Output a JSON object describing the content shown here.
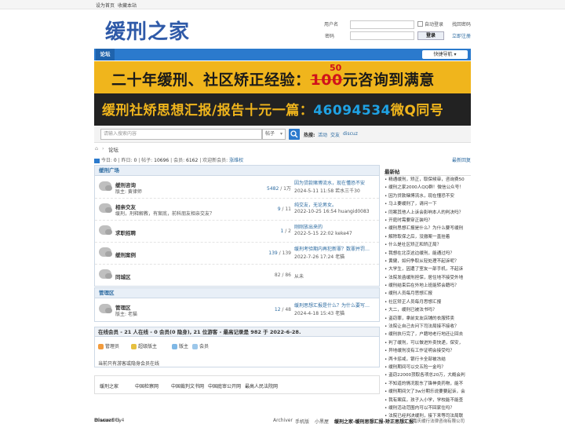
{
  "topbar": {
    "set_home": "设为首页",
    "bookmark": "收藏本站"
  },
  "logo": "缓刑之家",
  "login": {
    "user_label": "用户名",
    "auto_login": "自动登录",
    "forgot": "找回密码",
    "pass_label": "密码",
    "button": "登录",
    "register": "立即注册"
  },
  "nav": {
    "forum": "论坛",
    "quick": "快捷导航"
  },
  "banner": {
    "line1_a": "二十年缓刑、社区矫正经验：",
    "price_old": "100",
    "price_new": "50",
    "line1_b": "元咨询到满意",
    "line2_a": "缓刑社矫思想汇报/报告十元一篇：",
    "qq": "46094534",
    "line2_b": "微Q同号"
  },
  "search": {
    "placeholder": "请输入搜索内容",
    "scope": "帖子",
    "hot_label": "热搜:",
    "hot": [
      "活动",
      "交友",
      "discuz"
    ]
  },
  "breadcrumb": {
    "current": "论坛"
  },
  "stats": {
    "today_label": "今日:",
    "today": "0",
    "yesterday_label": "昨日:",
    "yesterday": "0",
    "posts_label": "帖子:",
    "posts": "10696",
    "members_label": "会员:",
    "members": "6162",
    "welcome_label": "欢迎新会员:",
    "newest": "涨维权",
    "latest_reply": "最新回复"
  },
  "sections": [
    {
      "title": "缓刑广场",
      "forums": [
        {
          "name": "缓刑咨询",
          "desc": "版主: 黄律师",
          "count": "5482",
          "total": "1万",
          "last_title": "因为贷款赌博流水，现在懂恐不安",
          "last_meta": "2024-5-11 11:58 若水三千30"
        },
        {
          "name": "相亲交友",
          "desc": "缓刑，刑释解教，有案底，前科朋友相亲交友？",
          "count": "9",
          "total": "11",
          "last_title": "纯交友，无论男女。",
          "last_meta": "2022-10-25 16:54 huangid0083"
        },
        {
          "name": "求职招聘",
          "desc": "",
          "count": "1",
          "total": "2",
          "last_title": "刚刚放出来的",
          "last_meta": "2022-5-15 22:02 keke47"
        },
        {
          "name": "缓刑案例",
          "desc": "",
          "count": "139",
          "total": "139",
          "last_title": "缓刑考验期内再犯新罪？数罪并罚…",
          "last_meta": "2022-7-26 17:24 老猫"
        },
        {
          "name": "同城区",
          "desc": "",
          "count": "82",
          "total": "86",
          "last_title": "从未",
          "last_meta": ""
        }
      ]
    },
    {
      "title": "管理区",
      "forums": [
        {
          "name": "管理区",
          "desc": "版主: 老猫",
          "count": "12",
          "total": "48",
          "last_title": "缓刑思想汇报是什么？为什么要写…",
          "last_meta": "2024-4-18 15:43 老猫"
        }
      ]
    }
  ],
  "online": {
    "title": "在线会员 - 21 人在线 - 0 会员(0 隐身), 21 位游客 - 最高记录是 982 于 2022-6-28.",
    "legend": [
      "管理员",
      "超级版主",
      "版主",
      "会员"
    ],
    "note": "当前只有游客或隐身会员在线"
  },
  "friend_links": [
    "缓刑之家",
    "中国检察网",
    "中国裁判文书网",
    "中国庭审公开网",
    "最高人民法院网"
  ],
  "sidebar": {
    "title": "最新帖",
    "posts": [
      "精通缓刑，矫正，取保候审，咨询费50",
      "缓刑之家2000人QQ群！微信公众号！",
      "因为贷款赌博流水，现在懂恐不安",
      "马上要缓刑了，请问一下",
      "同案其他人上诉会影响本人的判决吗？",
      "开庭时需要穿正装吗？",
      "缓刑思想汇报是什么？为什么要写缓刑",
      "解除取保之后，没撤案一直挂着",
      "什么是社区矫正和矫正局？",
      "我想在北京这边缓刑，能通过吗？",
      "黄健，如何争取从轻处理不起诉呢？",
      "大学生，因遭了室友一部手机，不起诉",
      "法院发函缓刑担保，居住地不接受外地",
      "缓刑结束后在外地上班能转会籍吗？",
      "缓刑人员每月思想汇报",
      "社区矫正人员每月思想汇报",
      "大二，缓刑已被法书吗？",
      "盗窃罪，拿前女友店铺的衣服转卖",
      "法院让自己去问下司法局接不接收？",
      "缓刑执行完了，户籍地老行地还让回去",
      "判了缓刑，可以做进外卖快递，保安，",
      "异地缓刑没有工作证明会接受吗？",
      "两卡惩戒，银行卡全部被冻结",
      "缓刑期间可以交五险一金吗？",
      "盗窃22000顶取各项总20万，大概会判",
      "不知道的情况股东了锋神类药物，能不",
      "缓刑期间欠了3w分期乐说要要起诉，会",
      "我有案底，孩子入小学，学校能不能查",
      "缓刑活动范围内可以不回家住吗？",
      "法院已经判决缓刑，接下来等司法局联"
    ]
  },
  "footer": {
    "powered": "Powered by",
    "brand": "Discuz!",
    "version": "X3.4",
    "links": [
      "Archiver",
      "手机版",
      "小黑屋"
    ],
    "site": "缓刑之家-缓刑思想汇报-矫正思想汇报",
    "company": "嘉庆缓行法律咨询有限公司"
  }
}
